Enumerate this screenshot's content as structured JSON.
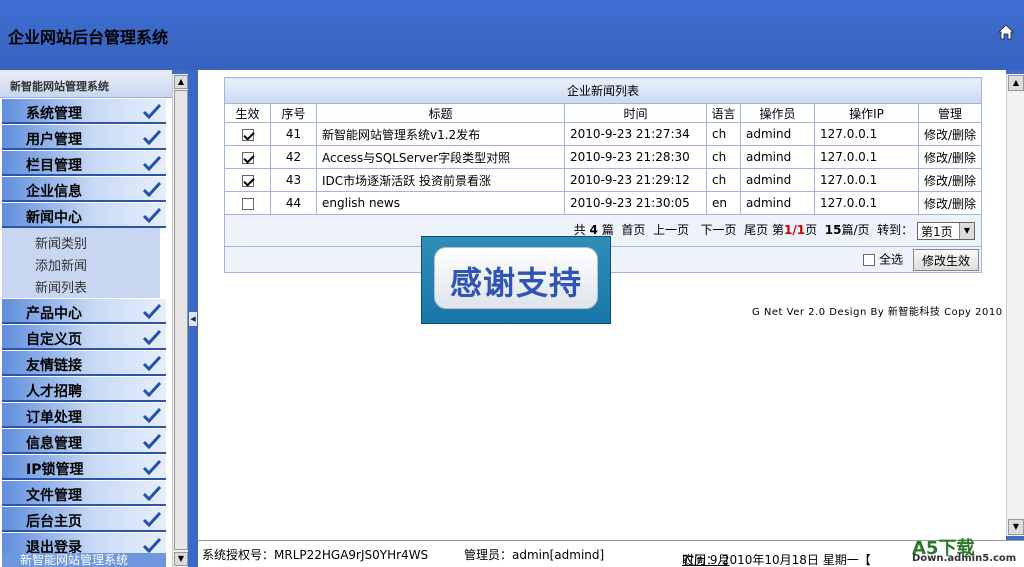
{
  "header": {
    "title": "企业网站后台管理系统",
    "home_icon": "home-icon"
  },
  "sidebar": {
    "top_title": "新智能网站管理系统",
    "items": [
      {
        "label": "系统管理"
      },
      {
        "label": "用户管理"
      },
      {
        "label": "栏目管理"
      },
      {
        "label": "企业信息"
      },
      {
        "label": "新闻中心",
        "expanded": true,
        "children": [
          "新闻类别",
          "添加新闻",
          "新闻列表"
        ]
      },
      {
        "label": "产品中心"
      },
      {
        "label": "自定义页"
      },
      {
        "label": "友情链接"
      },
      {
        "label": "人才招聘"
      },
      {
        "label": "订单处理"
      },
      {
        "label": "信息管理"
      },
      {
        "label": "IP锁管理"
      },
      {
        "label": "文件管理"
      },
      {
        "label": "后台主页"
      },
      {
        "label": "退出登录"
      }
    ],
    "bottom_title": "新智能网站管理系统"
  },
  "table": {
    "caption": "企业新闻列表",
    "columns": [
      "生效",
      "序号",
      "标题",
      "时间",
      "语言",
      "操作员",
      "操作IP",
      "管理"
    ],
    "rows": [
      {
        "active": true,
        "id": "41",
        "title": "新智能网站管理系统v1.2发布",
        "time": "2010-9-23 21:27:34",
        "lang": "ch",
        "operator": "admind",
        "ip": "127.0.0.1",
        "manage": "修改/删除"
      },
      {
        "active": true,
        "id": "42",
        "title": "Access与SQLServer字段类型对照",
        "time": "2010-9-23 21:28:30",
        "lang": "ch",
        "operator": "admind",
        "ip": "127.0.0.1",
        "manage": "修改/删除"
      },
      {
        "active": true,
        "id": "43",
        "title": "IDC市场逐渐活跃 投资前景看涨",
        "time": "2010-9-23 21:29:12",
        "lang": "ch",
        "operator": "admind",
        "ip": "127.0.0.1",
        "manage": "修改/删除"
      },
      {
        "active": false,
        "id": "44",
        "title": "english news",
        "time": "2010-9-23 21:30:05",
        "lang": "en",
        "operator": "admind",
        "ip": "127.0.0.1",
        "manage": "修改/删除"
      }
    ],
    "pager": {
      "total_prefix": "共",
      "total": "4",
      "total_suffix": "篇",
      "first": "首页",
      "prev": "上一页",
      "next": "下一页",
      "last": "尾页",
      "page_prefix": "第",
      "page": "1/1",
      "page_suffix": "页",
      "per_page": "15",
      "per_page_suffix": "篇/页",
      "goto_label": "转到：",
      "goto_value": "第1页"
    },
    "select_all_label": "全选",
    "apply_button": "修改生效"
  },
  "credit": "G Net Ver 2.0 Design By 新智能科技 Copy 2010",
  "overlay": {
    "text": "感谢支持"
  },
  "status": {
    "license": "系统授权号：MRLP22HGA9rJS0YHr4WS",
    "admin": "管理员：admin[admind]",
    "time": "时间： 2010年10月18日 星期一【",
    "lunar": "农历 9月 ",
    "watermark_main": "A5下载",
    "watermark_sub": "Down.admin5.com"
  }
}
